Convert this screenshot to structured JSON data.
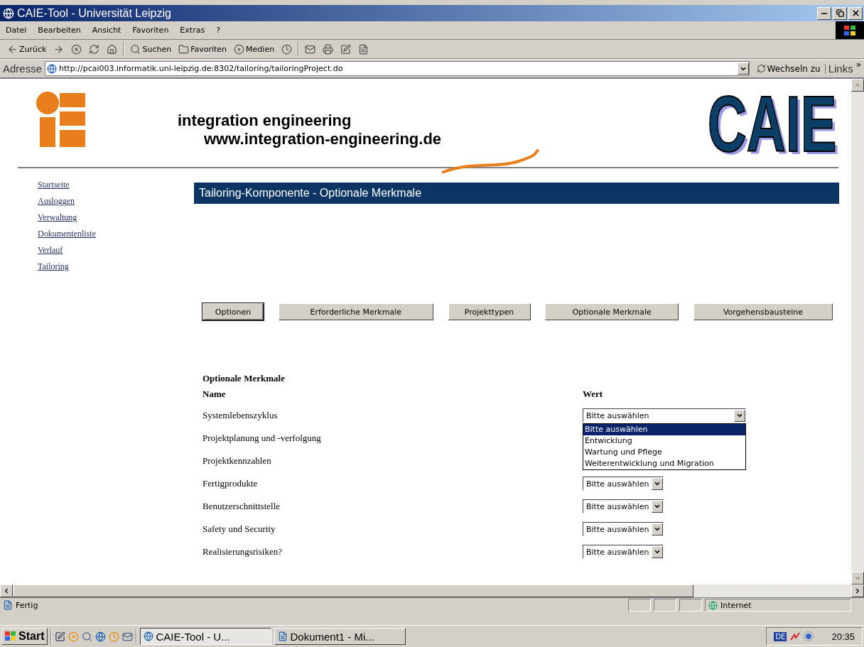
{
  "window": {
    "title": "CAIE-Tool - Universität Leipzig"
  },
  "menu": [
    "Datei",
    "Bearbeiten",
    "Ansicht",
    "Favoriten",
    "Extras",
    "?"
  ],
  "toolbar": [
    {
      "kind": "back",
      "label": "Zurück"
    },
    {
      "kind": "forward"
    },
    {
      "kind": "stop"
    },
    {
      "kind": "refresh"
    },
    {
      "kind": "home"
    },
    {
      "kind": "search",
      "label": "Suchen"
    },
    {
      "kind": "favorites",
      "label": "Favoriten"
    },
    {
      "kind": "media",
      "label": "Medien"
    },
    {
      "kind": "history"
    },
    {
      "kind": "mail"
    },
    {
      "kind": "print"
    },
    {
      "kind": "edit"
    },
    {
      "kind": "discuss"
    }
  ],
  "address": {
    "label": "Adresse",
    "url": "http://pcai003.informatik.uni-leipzig.de:8302/tailoring/tailoringProject.do",
    "go": "Wechseln zu",
    "links": "Links",
    "more": "»"
  },
  "header": {
    "line1": "integration engineering",
    "line2": "www.integration-engineering.de",
    "logo": "CAIE"
  },
  "nav": [
    "Startseite",
    "Ausloggen",
    "Verwaltung",
    "Dokumentenliste",
    "Verlauf",
    "Tailoring"
  ],
  "heading": "Tailoring-Komponente - Optionale Merkmale",
  "buttons": [
    {
      "label": "Optionen",
      "selected": true
    },
    {
      "label": "Erforderliche Merkmale",
      "selected": false
    },
    {
      "label": "Projekttypen",
      "selected": false
    },
    {
      "label": "Optionale Merkmale",
      "selected": false
    },
    {
      "label": "Vorgehensbausteine",
      "selected": false
    }
  ],
  "form": {
    "title": "Optionale Merkmale",
    "columns": [
      "Name",
      "Wert"
    ],
    "rows": [
      {
        "name": "Systemlebenszyklus",
        "select": {
          "value": "Bitte auswählen",
          "expanded": true,
          "options": [
            {
              "label": "Bitte auswählen",
              "selected": true
            },
            {
              "label": "Entwicklung",
              "selected": false
            },
            {
              "label": "Wartung und Pflege",
              "selected": false
            },
            {
              "label": "Weiterentwicklung und Migration",
              "selected": false
            }
          ]
        }
      },
      {
        "name": "Projektplanung und -verfolgung"
      },
      {
        "name": "Projektkennzahlen"
      },
      {
        "name": "Fertigprodukte",
        "select": {
          "value": "Bitte auswählen",
          "expanded": false
        }
      },
      {
        "name": "Benutzerschnittstelle",
        "select": {
          "value": "Bitte auswählen",
          "expanded": false
        }
      },
      {
        "name": "Safety und Security",
        "select": {
          "value": "Bitte auswählen",
          "expanded": false
        }
      },
      {
        "name": "Realisierungsrisiken?",
        "select": {
          "value": "Bitte auswählen",
          "expanded": false
        }
      }
    ]
  },
  "status": {
    "text": "Fertig",
    "zone": "Internet"
  },
  "taskbar": {
    "start": "Start",
    "tasks": [
      {
        "label": "CAIE-Tool - U...",
        "selected": true
      },
      {
        "label": "Dokument1 - Mi...",
        "selected": false
      }
    ],
    "lang": "DE",
    "clock": "20:35"
  }
}
